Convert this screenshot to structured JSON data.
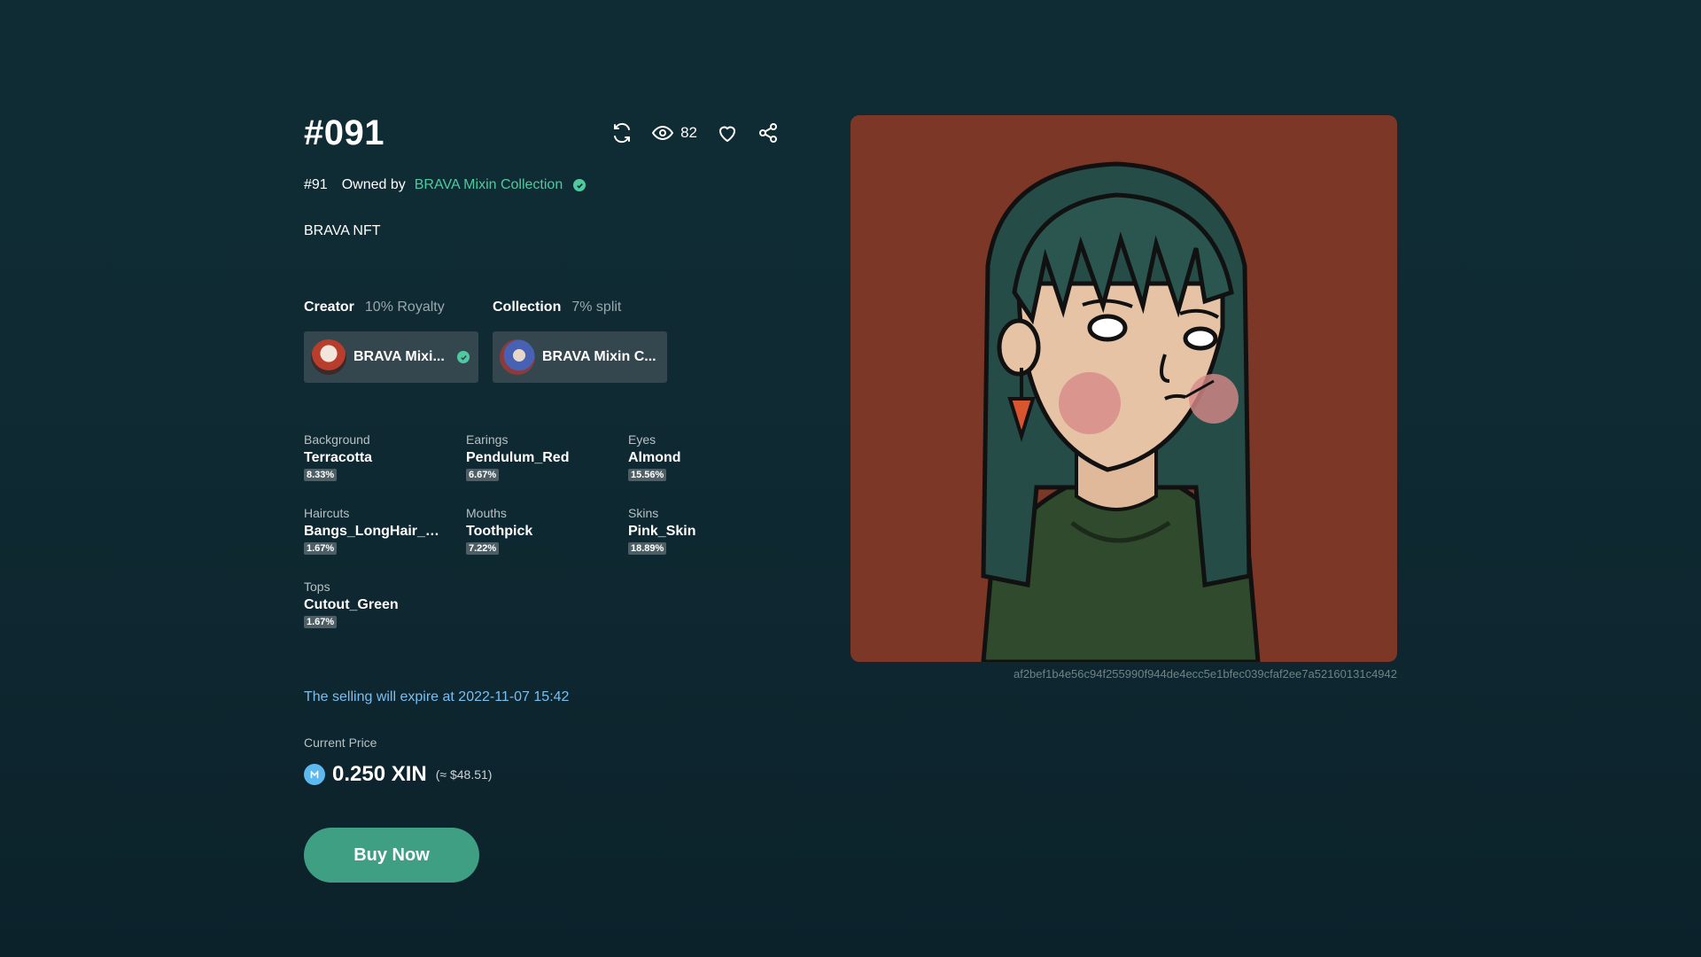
{
  "nft": {
    "title": "#091",
    "views": "82",
    "token_number": "#91",
    "owned_by_label": "Owned by",
    "owner": "BRAVA Mixin Collection",
    "description": "BRAVA NFT",
    "hash": "af2bef1b4e56c94f255990f944de4ecc5e1bfec039cfaf2ee7a52160131c4942"
  },
  "roles": {
    "creator_label": "Creator",
    "creator_royalty": "10% Royalty",
    "creator_name": "BRAVA Mixi...",
    "collection_label": "Collection",
    "collection_split": "7% split",
    "collection_name": "BRAVA Mixin C..."
  },
  "traits": [
    {
      "key": "Background",
      "value": "Terracotta",
      "percent": "8.33%"
    },
    {
      "key": "Earings",
      "value": "Pendulum_Red",
      "percent": "6.67%"
    },
    {
      "key": "Eyes",
      "value": "Almond",
      "percent": "15.56%"
    },
    {
      "key": "Haircuts",
      "value": "Bangs_LongHair_Gre...",
      "percent": "1.67%"
    },
    {
      "key": "Mouths",
      "value": "Toothpick",
      "percent": "7.22%"
    },
    {
      "key": "Skins",
      "value": "Pink_Skin",
      "percent": "18.89%"
    },
    {
      "key": "Tops",
      "value": "Cutout_Green",
      "percent": "1.67%"
    }
  ],
  "sale": {
    "expire_text": "The selling will expire at 2022-11-07 15:42",
    "price_label": "Current Price",
    "price": "0.250 XIN",
    "price_usd": "(≈ $48.51)",
    "buy_label": "Buy Now"
  },
  "icons": {
    "refresh": "refresh-icon",
    "views": "eye-icon",
    "like": "heart-icon",
    "share": "share-icon",
    "verified": "check-circle-icon",
    "currency": "xin-coin-icon"
  },
  "colors": {
    "background": "#0f2c34",
    "accent_green": "#4fcaa0",
    "button": "#3f9f83",
    "link_blue": "#79bff0",
    "art_background": "#7d3727"
  }
}
